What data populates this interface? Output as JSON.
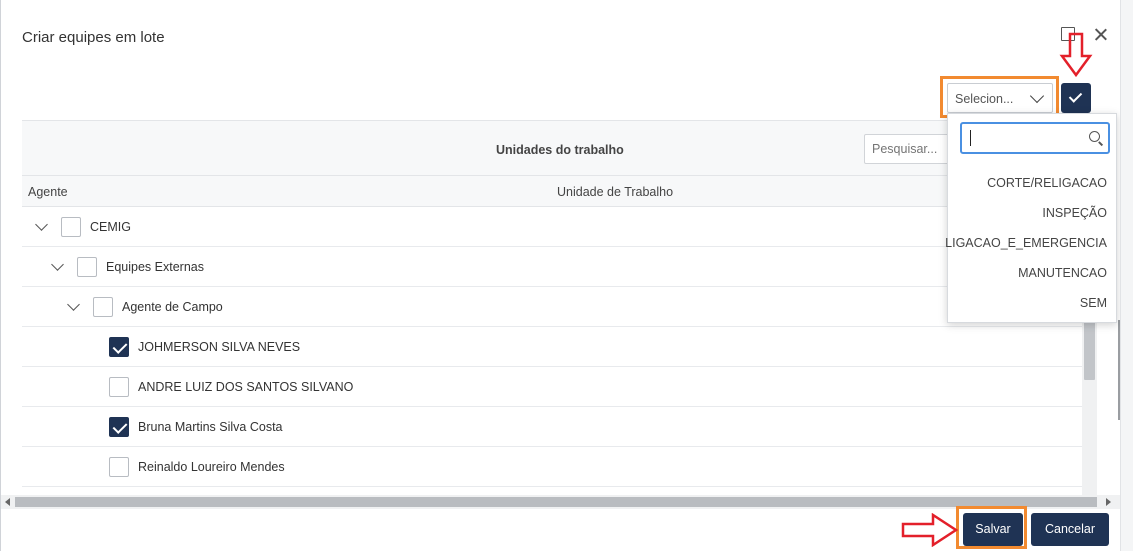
{
  "dialog": {
    "title": "Criar equipes em lote"
  },
  "selector": {
    "value": "Selecion...",
    "apply_icon": "check-icon"
  },
  "grid": {
    "toolbar_title": "Unidades do trabalho",
    "search_placeholder": "Pesquisar...",
    "columns": [
      "Agente",
      "Unidade de Trabalho"
    ],
    "rows": [
      {
        "label": "CEMIG",
        "checked": false,
        "expandable": true
      },
      {
        "label": "Equipes Externas",
        "checked": false,
        "expandable": true
      },
      {
        "label": "Agente de Campo",
        "checked": false,
        "expandable": true
      },
      {
        "label": "JOHMERSON SILVA NEVES",
        "checked": true,
        "expandable": false
      },
      {
        "label": "ANDRE LUIZ DOS SANTOS SILVANO",
        "checked": false,
        "expandable": false
      },
      {
        "label": "Bruna Martins Silva Costa",
        "checked": true,
        "expandable": false
      },
      {
        "label": "Reinaldo Loureiro Mendes",
        "checked": false,
        "expandable": false
      }
    ]
  },
  "dropdown": {
    "search_value": "",
    "options": [
      "CORTE/RELIGACAO",
      "INSPEÇÃO",
      "LIGACAO_E_EMERGENCIA",
      "MANUTENCAO",
      "SEM"
    ]
  },
  "footer": {
    "save_label": "Salvar",
    "cancel_label": "Cancelar"
  },
  "annotations": {
    "highlight_color": "#f28a30",
    "arrow_color": "#e3202a"
  }
}
